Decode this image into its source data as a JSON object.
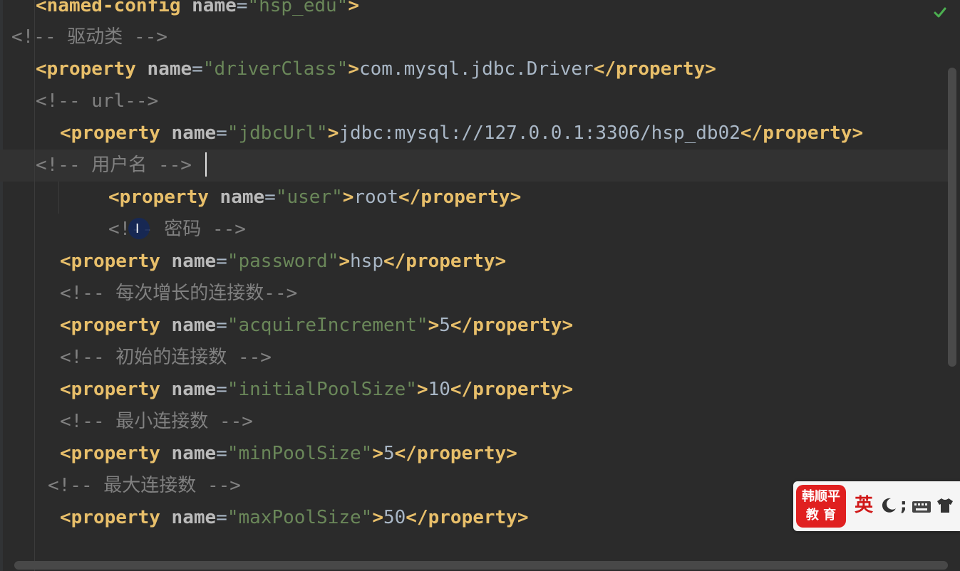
{
  "editor": {
    "lines": [
      {
        "parts": [
          {
            "t": "tag",
            "v": "<named-config "
          },
          {
            "t": "attr",
            "v": "name"
          },
          {
            "t": "eq",
            "v": "="
          },
          {
            "t": "val",
            "v": "\"hsp_edu\""
          },
          {
            "t": "tag",
            "v": ">"
          }
        ]
      },
      {
        "parts": [
          {
            "t": "comment",
            "v": "<!-- "
          },
          {
            "t": "comment cjk",
            "v": "驱动类"
          },
          {
            "t": "comment",
            "v": " -->"
          }
        ]
      },
      {
        "parts": [
          {
            "t": "tag",
            "v": "<property "
          },
          {
            "t": "attr",
            "v": "name"
          },
          {
            "t": "eq",
            "v": "="
          },
          {
            "t": "val",
            "v": "\"driverClass\""
          },
          {
            "t": "tag",
            "v": ">"
          },
          {
            "t": "text",
            "v": "com.mysql.jdbc.Driver"
          },
          {
            "t": "tag",
            "v": "</property>"
          }
        ]
      },
      {
        "parts": [
          {
            "t": "comment",
            "v": "<!-- url-->"
          }
        ]
      },
      {
        "parts": [
          {
            "t": "tag",
            "v": "<property "
          },
          {
            "t": "attr",
            "v": "name"
          },
          {
            "t": "eq",
            "v": "="
          },
          {
            "t": "val",
            "v": "\"jdbcUrl\""
          },
          {
            "t": "tag",
            "v": ">"
          },
          {
            "t": "text",
            "v": "jdbc:mysql://127.0.0.1:3306/hsp_db02"
          },
          {
            "t": "tag",
            "v": "</property>"
          }
        ]
      },
      {
        "parts": [
          {
            "t": "comment",
            "v": "<!-- "
          },
          {
            "t": "comment cjk",
            "v": "用户名"
          },
          {
            "t": "comment",
            "v": " -->"
          }
        ]
      },
      {
        "parts": [
          {
            "t": "tag",
            "v": "<property "
          },
          {
            "t": "attr",
            "v": "name"
          },
          {
            "t": "eq",
            "v": "="
          },
          {
            "t": "val",
            "v": "\"user\""
          },
          {
            "t": "tag",
            "v": ">"
          },
          {
            "t": "text",
            "v": "root"
          },
          {
            "t": "tag",
            "v": "</property>"
          }
        ]
      },
      {
        "parts": [
          {
            "t": "comment",
            "v": "<!-- "
          },
          {
            "t": "comment cjk",
            "v": "密码"
          },
          {
            "t": "comment",
            "v": " -->"
          }
        ]
      },
      {
        "parts": [
          {
            "t": "tag",
            "v": "<property "
          },
          {
            "t": "attr",
            "v": "name"
          },
          {
            "t": "eq",
            "v": "="
          },
          {
            "t": "val",
            "v": "\"password\""
          },
          {
            "t": "tag",
            "v": ">"
          },
          {
            "t": "text",
            "v": "hsp"
          },
          {
            "t": "tag",
            "v": "</property>"
          }
        ]
      },
      {
        "parts": [
          {
            "t": "comment",
            "v": "<!-- "
          },
          {
            "t": "comment cjk",
            "v": "每次增长的连接数"
          },
          {
            "t": "comment",
            "v": "-->"
          }
        ]
      },
      {
        "parts": [
          {
            "t": "tag",
            "v": "<property "
          },
          {
            "t": "attr",
            "v": "name"
          },
          {
            "t": "eq",
            "v": "="
          },
          {
            "t": "val",
            "v": "\"acquireIncrement\""
          },
          {
            "t": "tag",
            "v": ">"
          },
          {
            "t": "text",
            "v": "5"
          },
          {
            "t": "tag",
            "v": "</property>"
          }
        ]
      },
      {
        "parts": [
          {
            "t": "comment",
            "v": "<!-- "
          },
          {
            "t": "comment cjk",
            "v": "初始的连接数"
          },
          {
            "t": "comment",
            "v": " -->"
          }
        ]
      },
      {
        "parts": [
          {
            "t": "tag",
            "v": "<property "
          },
          {
            "t": "attr",
            "v": "name"
          },
          {
            "t": "eq",
            "v": "="
          },
          {
            "t": "val",
            "v": "\"initialPoolSize\""
          },
          {
            "t": "tag",
            "v": ">"
          },
          {
            "t": "text",
            "v": "10"
          },
          {
            "t": "tag",
            "v": "</property>"
          }
        ]
      },
      {
        "parts": [
          {
            "t": "comment",
            "v": "<!-- "
          },
          {
            "t": "comment cjk",
            "v": "最小连接数"
          },
          {
            "t": "comment",
            "v": " -->"
          }
        ]
      },
      {
        "parts": [
          {
            "t": "tag",
            "v": "<property "
          },
          {
            "t": "attr",
            "v": "name"
          },
          {
            "t": "eq",
            "v": "="
          },
          {
            "t": "val",
            "v": "\"minPoolSize\""
          },
          {
            "t": "tag",
            "v": ">"
          },
          {
            "t": "text",
            "v": "5"
          },
          {
            "t": "tag",
            "v": "</property>"
          }
        ]
      },
      {
        "parts": [
          {
            "t": "comment",
            "v": "<!-- "
          },
          {
            "t": "comment cjk",
            "v": "最大连接数"
          },
          {
            "t": "comment",
            "v": " -->"
          }
        ]
      },
      {
        "parts": [
          {
            "t": "tag",
            "v": "<property "
          },
          {
            "t": "attr",
            "v": "name"
          },
          {
            "t": "eq",
            "v": "="
          },
          {
            "t": "val",
            "v": "\"maxPoolSize\""
          },
          {
            "t": "tag",
            "v": ">"
          },
          {
            "t": "text",
            "v": "50"
          },
          {
            "t": "tag",
            "v": "</property>"
          }
        ]
      }
    ]
  },
  "ime_toolbar": {
    "logo_line1": "韩顺平",
    "logo_line2": "教 育",
    "language": "英",
    "punctuation": ";",
    "brand_color": "#e02020",
    "icons": [
      "moon-icon",
      "keyboard-icon",
      "shirt-icon"
    ]
  },
  "status": {
    "inspection_icon": "check-icon",
    "color": "#4caf50"
  }
}
